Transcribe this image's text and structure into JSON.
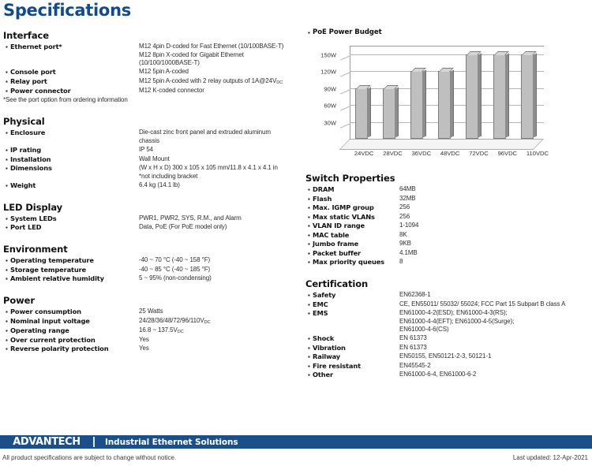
{
  "page_title": "Specifications",
  "colors": {
    "title_blue": "#124a8b",
    "footer_blue": "#1b4f8a",
    "bar_face": "#bfbfbf",
    "bar_side": "#8d8d8d",
    "bar_top": "#d6d6d6"
  },
  "left_sections": [
    {
      "title": "Interface",
      "rows": [
        {
          "label": "Ethernet port*",
          "value": "M12 4pin D-coded for Fast Ethernet (10/100BASE-T)\nM12 8pin X-coded for Gigabit Ethernet\n(10/100/1000BASE-T)"
        },
        {
          "label": "Console port",
          "value": "M12 5pin A-coded"
        },
        {
          "label": "Relay port",
          "value": "M12 5pin A-coded with 2 relay outputs of 1A@24V",
          "sub": "DC"
        },
        {
          "label": "Power connector",
          "value": "M12 K-coded connector"
        }
      ],
      "note": "*See the port option from ordering information"
    },
    {
      "title": "Physical",
      "rows": [
        {
          "label": "Enclosure",
          "value": "Die-cast zinc front panel and extruded aluminum\nchassis"
        },
        {
          "label": "IP rating",
          "value": "IP 54"
        },
        {
          "label": "Installation",
          "value": "Wall Mount"
        },
        {
          "label": "Dimensions",
          "value": "(W x H x D) 300 x 105 x 105 mm/11.8 x 4.1 x 4.1 in\n*not including bracket"
        },
        {
          "label": "Weight",
          "value": "6.4 kg (14.1 lb)"
        }
      ]
    },
    {
      "title": "LED Display",
      "rows": [
        {
          "label": "System LEDs",
          "value": "PWR1, PWR2, SYS, R.M., and Alarm"
        },
        {
          "label": "Port LED",
          "value": "Data, PoE (For PoE model only)"
        }
      ]
    },
    {
      "title": "Environment",
      "rows": [
        {
          "label": "Operating temperature",
          "value": "-40 ~ 70 °C (-40 ~ 158 °F)"
        },
        {
          "label": "Storage temperature",
          "value": "-40 ~ 85 °C (-40 ~ 185 °F)"
        },
        {
          "label": "Ambient relative humidity",
          "value": "5 ~ 95% (non-condensing)"
        }
      ]
    },
    {
      "title": "Power",
      "rows": [
        {
          "label": "Power consumption",
          "value": "25 Watts"
        },
        {
          "label": "Nominal input voltage",
          "value": "24/28/36/48/72/96/110V",
          "sub": "DC"
        },
        {
          "label": "Operating range",
          "value": "16.8 ~ 137.5V",
          "sub": "DC"
        },
        {
          "label": "Over current protection",
          "value": "Yes"
        },
        {
          "label": "Reverse polarity protection",
          "value": "Yes"
        }
      ]
    }
  ],
  "chart_data": {
    "type": "bar",
    "title": "PoE Power Budget",
    "categories": [
      "24VDC",
      "28VDC",
      "36VDC",
      "48VDC",
      "72VDC",
      "96VDC",
      "110VDC"
    ],
    "values": [
      90,
      90,
      120,
      120,
      150,
      150,
      150
    ],
    "ytick_labels": [
      "150W",
      "120W",
      "90W",
      "60W",
      "30W"
    ],
    "ytick_values": [
      150,
      120,
      90,
      60,
      30
    ],
    "ylim": [
      0,
      165
    ],
    "xlabel": "",
    "ylabel": "",
    "grid": true,
    "legend": "none"
  },
  "right_sections": [
    {
      "title": "Switch Properties",
      "rows": [
        {
          "label": "DRAM",
          "value": "64MB"
        },
        {
          "label": "Flash",
          "value": "32MB"
        },
        {
          "label": "Max. IGMP group",
          "value": "256"
        },
        {
          "label": "Max static VLANs",
          "value": "256"
        },
        {
          "label": "VLAN ID range",
          "value": "1-1094"
        },
        {
          "label": "MAC table",
          "value": "8K"
        },
        {
          "label": "Jumbo frame",
          "value": "9KB"
        },
        {
          "label": "Packet buffer",
          "value": "4.1MB"
        },
        {
          "label": "Max priority queues",
          "value": "8"
        }
      ]
    },
    {
      "title": "Certification",
      "rows": [
        {
          "label": "Safety",
          "value": "EN62368-1"
        },
        {
          "label": "EMC",
          "value": "CE, EN55011/ 55032/ 55024; FCC Part 15 Subpart B class A"
        },
        {
          "label": "EMS",
          "value": "EN61000-4-2(ESD); EN61000-4-3(RS);\nEN61000-4-4(EFT); EN61000-4-5(Surge);\nEN61000-4-6(CS)"
        },
        {
          "label": "Shock",
          "value": "EN 61373"
        },
        {
          "label": "Vibration",
          "value": "EN 61373"
        },
        {
          "label": "Railway",
          "value": "EN50155, EN50121-2-3, 50121-1"
        },
        {
          "label": "Fire resistant",
          "value": "EN45545-2"
        },
        {
          "label": "Other",
          "value": "EN61000-6-4, EN61000-6-2"
        }
      ]
    }
  ],
  "footer": {
    "logo": "ADVANTECH",
    "tagline": "Industrial Ethernet Solutions",
    "note": "All product specifications are subject to change without notice.",
    "updated": "Last updated: 12-Apr-2021"
  }
}
